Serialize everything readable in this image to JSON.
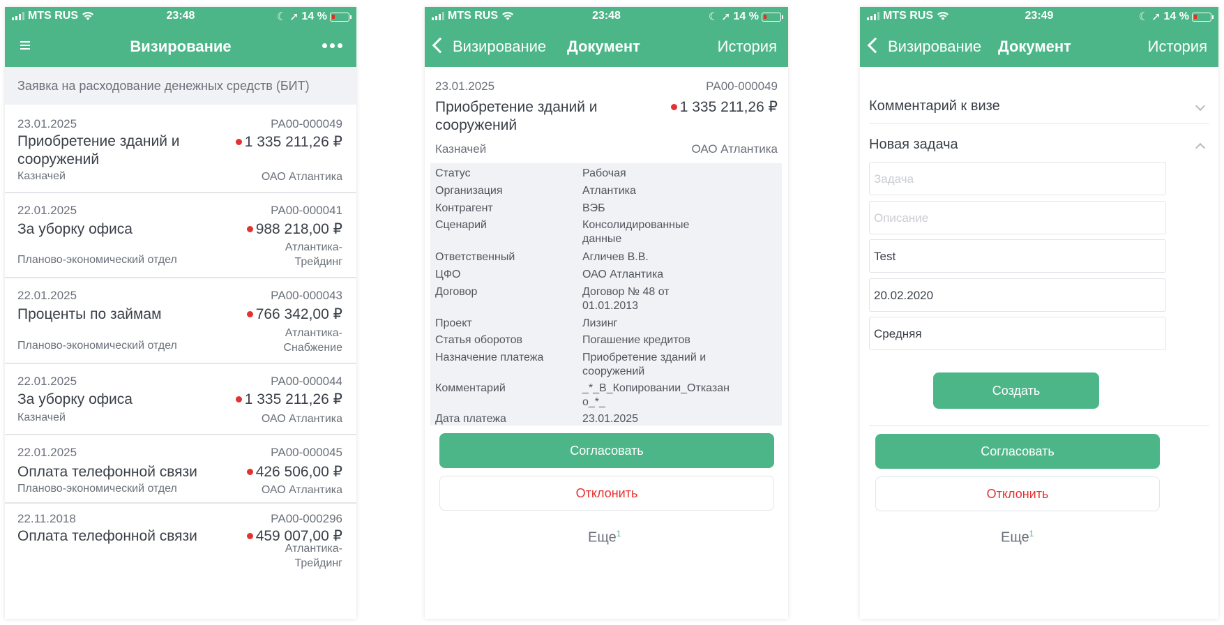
{
  "status_bar": [
    {
      "carrier": "MTS RUS",
      "time": "23:48",
      "battery": "14 %"
    },
    {
      "carrier": "MTS RUS",
      "time": "23:48",
      "battery": "14 %"
    },
    {
      "carrier": "MTS RUS",
      "time": "23:49",
      "battery": "14 %"
    }
  ],
  "colors": {
    "accent": "#4db688",
    "danger": "#e3322f",
    "background_grey": "#f1f2f5"
  },
  "list_screen": {
    "title": "Визирование",
    "subheader": "Заявка на расходование денежных средств (БИТ)",
    "items": [
      {
        "date": "23.01.2025",
        "number": "РА00-000049",
        "title": "Приобретение зданий и сооружений",
        "amount": "1 335 211,26 ₽",
        "department": "Казначей",
        "org": "ОАО Атлантика"
      },
      {
        "date": "22.01.2025",
        "number": "РА00-000041",
        "title": "За уборку офиса",
        "amount": "988 218,00 ₽",
        "department": "Планово-экономический отдел",
        "org": "Атлантика-Трейдинг"
      },
      {
        "date": "22.01.2025",
        "number": "РА00-000043",
        "title": "Проценты по займам",
        "amount": "766 342,00 ₽",
        "department": "Планово-экономический отдел",
        "org": "Атлантика-Снабжение"
      },
      {
        "date": "22.01.2025",
        "number": "РА00-000044",
        "title": "За уборку офиса",
        "amount": "1 335 211,26 ₽",
        "department": "Казначей",
        "org": "ОАО Атлантика"
      },
      {
        "date": "22.01.2025",
        "number": "РА00-000045",
        "title": "Оплата телефонной связи",
        "amount": "426 506,00 ₽",
        "department": "Планово-экономический отдел",
        "org": "ОАО Атлантика"
      },
      {
        "date": "22.11.2018",
        "number": "РА00-000296",
        "title": "Оплата телефонной связи",
        "amount": "459 007,00 ₽",
        "department": "",
        "org": "Атлантика-Трейдинг"
      }
    ]
  },
  "document_screen": {
    "back_label": "Визирование",
    "title": "Документ",
    "history_label": "История",
    "date": "23.01.2025",
    "number": "РА00-000049",
    "doc_title": "Приобретение зданий и сооружений",
    "amount": "1 335 211,26 ₽",
    "department": "Казначей",
    "org": "ОАО Атлантика",
    "properties": [
      {
        "key": "Статус",
        "value": "Рабочая"
      },
      {
        "key": "Организация",
        "value": "Атлантика"
      },
      {
        "key": "Контрагент",
        "value": "ВЭБ"
      },
      {
        "key": "Сценарий",
        "value": "Консолидированные данные"
      },
      {
        "key": "Ответственный",
        "value": "Агличев В.В."
      },
      {
        "key": "ЦФО",
        "value": "ОАО Атлантика"
      },
      {
        "key": "Договор",
        "value": "Договор № 48 от 01.01.2013"
      },
      {
        "key": "Проект",
        "value": "Лизинг"
      },
      {
        "key": "Статья оборотов",
        "value": "Погашение кредитов"
      },
      {
        "key": "Назначение платежа",
        "value": "Приобретение зданий и сооружений"
      },
      {
        "key": "Комментарий",
        "value": "_*_В_Копировании_Отказано_*_"
      },
      {
        "key": "Дата платежа",
        "value": "23.01.2025"
      }
    ],
    "approve_label": "Согласовать",
    "reject_label": "Отклонить",
    "more_label": "Еще",
    "more_count": "1"
  },
  "task_screen": {
    "back_label": "Визирование",
    "title": "Документ",
    "history_label": "История",
    "comment_section": "Комментарий к визе",
    "new_task_section": "Новая задача",
    "task_placeholder": "Задача",
    "description_placeholder": "Описание",
    "assignee_value": "Test",
    "date_value": "20.02.2020",
    "priority_value": "Средняя",
    "create_label": "Создать",
    "approve_label": "Согласовать",
    "reject_label": "Отклонить",
    "more_label": "Еще",
    "more_count": "1"
  }
}
